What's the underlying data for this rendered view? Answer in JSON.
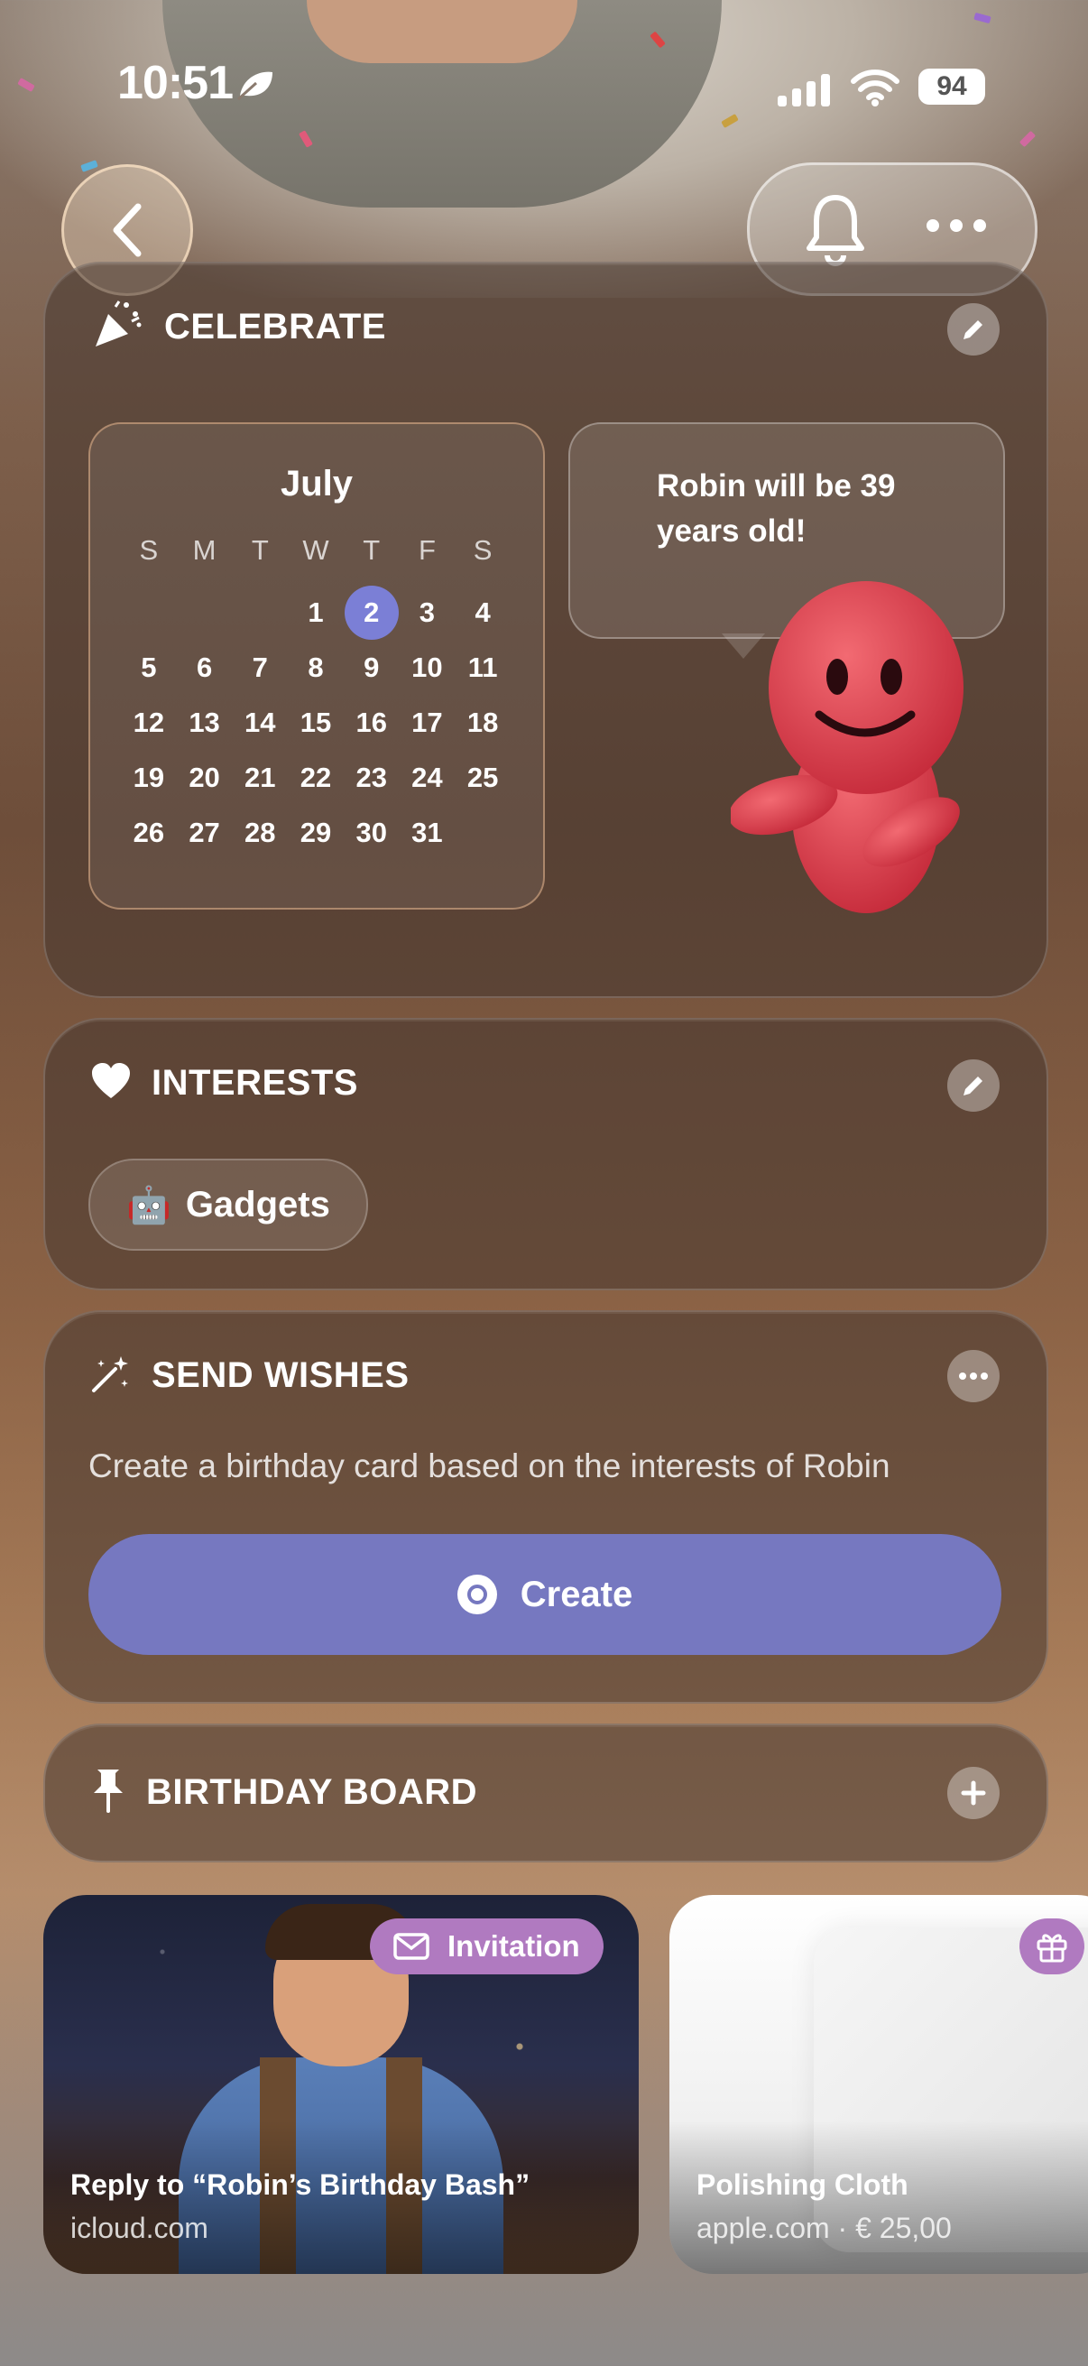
{
  "status_bar": {
    "time": "10:51",
    "battery": "94"
  },
  "celebrate": {
    "title": "CELEBRATE",
    "calendar": {
      "month": "July",
      "weekdays": [
        "S",
        "M",
        "T",
        "W",
        "T",
        "F",
        "S"
      ],
      "selected_day": "2",
      "rows": [
        [
          "",
          "",
          "",
          "1",
          "2",
          "3",
          "4"
        ],
        [
          "5",
          "6",
          "7",
          "8",
          "9",
          "10",
          "11"
        ],
        [
          "12",
          "13",
          "14",
          "15",
          "16",
          "17",
          "18"
        ],
        [
          "19",
          "20",
          "21",
          "22",
          "23",
          "24",
          "25"
        ],
        [
          "26",
          "27",
          "28",
          "29",
          "30",
          "31",
          ""
        ]
      ]
    },
    "bubble_text": "Robin will be 39 years old!"
  },
  "interests": {
    "title": "INTERESTS",
    "chip_emoji": "🤖",
    "chip_label": "Gadgets"
  },
  "send_wishes": {
    "title": "SEND WISHES",
    "description": "Create a birthday card based on the interests of Robin",
    "button_label": "Create"
  },
  "birthday_board": {
    "title": "BIRTHDAY BOARD",
    "tiles": [
      {
        "badge": "Invitation",
        "title": "Reply to “Robin’s Birthday Bash”",
        "subtitle": "icloud.com"
      },
      {
        "title": "Polishing Cloth",
        "subtitle": "apple.com · € 25,00"
      }
    ]
  },
  "colors": {
    "accent": "#7678c0",
    "selected_day": "#7b7fd6",
    "badge": "#b07ac0"
  }
}
